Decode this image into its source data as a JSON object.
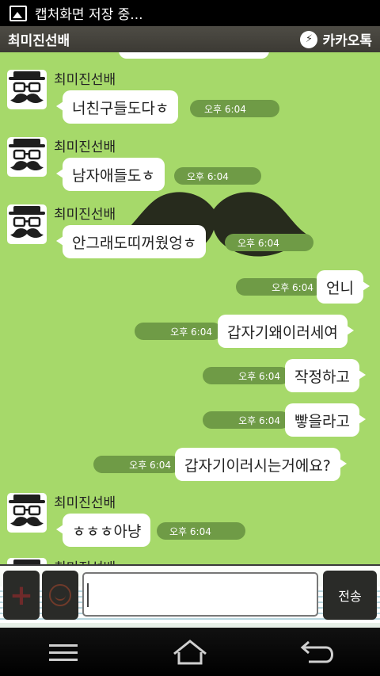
{
  "status": {
    "title": "캡처화면 저장 중..."
  },
  "header": {
    "contact_name": "최미진선배",
    "app_name": "카카오톡",
    "app_icon_glyph": "⚡"
  },
  "colors": {
    "chat_bg": "#a6d96a",
    "time_pill": "#6f9b46"
  },
  "messages": [
    {
      "side": "in",
      "name": "최미진선배",
      "text": "너친구들도다ㅎ",
      "time": "오후 6:04"
    },
    {
      "side": "in",
      "name": "최미진선배",
      "text": "남자애들도ㅎ",
      "time": "오후 6:04"
    },
    {
      "side": "in",
      "name": "최미진선배",
      "text": "안그래도띠꺼웠엉ㅎ",
      "time": "오후 6:04"
    },
    {
      "side": "out",
      "text": "언니",
      "time": "오후 6:04"
    },
    {
      "side": "out",
      "text": "갑자기왜이러세여",
      "time": "오후 6:04"
    },
    {
      "side": "out",
      "text": "작정하고",
      "time": "오후 6:04"
    },
    {
      "side": "out",
      "text": "빻을라고",
      "time": "오후 6:04"
    },
    {
      "side": "out",
      "text": "갑자기이러시는거에요?",
      "time": "오후 6:04"
    },
    {
      "side": "in",
      "name": "최미진선배",
      "text": "ㅎㅎㅎ아냥",
      "time": "오후 6:04"
    }
  ],
  "partial_name": "최미진선배",
  "input": {
    "plus_icon": "+",
    "send_label": "전송",
    "value": ""
  },
  "nav": {
    "menu_icon": "menu-icon",
    "home_icon": "home-icon",
    "back_icon": "back-icon"
  }
}
